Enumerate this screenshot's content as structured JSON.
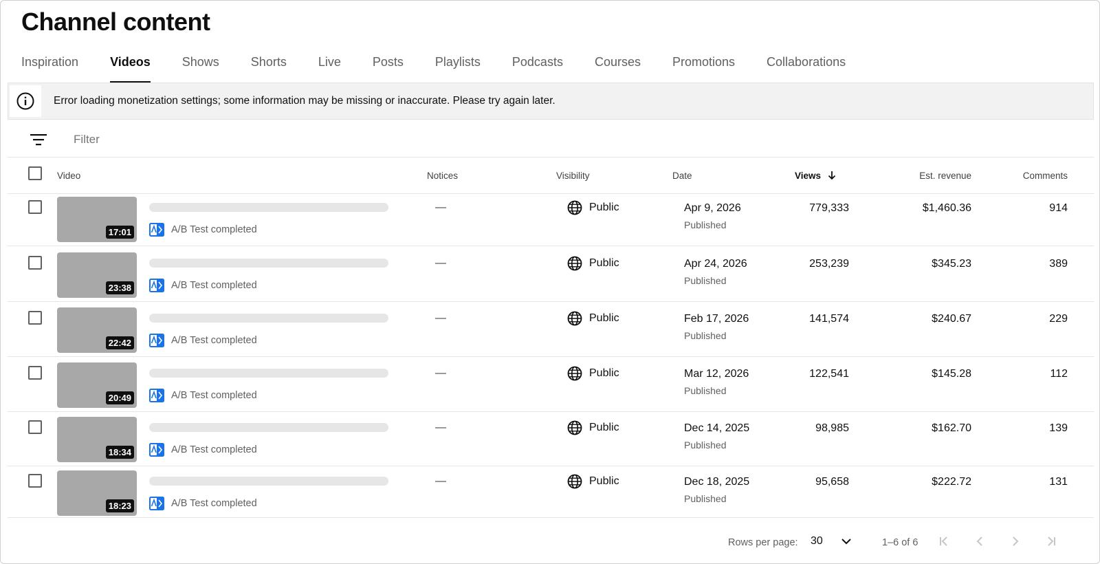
{
  "page": {
    "title": "Channel content"
  },
  "tabs": [
    {
      "label": "Inspiration",
      "active": false
    },
    {
      "label": "Videos",
      "active": true
    },
    {
      "label": "Shows",
      "active": false
    },
    {
      "label": "Shorts",
      "active": false
    },
    {
      "label": "Live",
      "active": false
    },
    {
      "label": "Posts",
      "active": false
    },
    {
      "label": "Playlists",
      "active": false
    },
    {
      "label": "Podcasts",
      "active": false
    },
    {
      "label": "Courses",
      "active": false
    },
    {
      "label": "Promotions",
      "active": false
    },
    {
      "label": "Collaborations",
      "active": false
    }
  ],
  "banner": {
    "icon": "info-icon",
    "text": "Error loading monetization settings; some information may be missing or inaccurate. Please try again later."
  },
  "filter": {
    "icon": "filter-icon",
    "placeholder": "Filter"
  },
  "table": {
    "headers": {
      "video": "Video",
      "notices": "Notices",
      "visibility": "Visibility",
      "date": "Date",
      "views": "Views",
      "revenue": "Est. revenue",
      "comments": "Comments"
    },
    "sort": {
      "column": "views",
      "direction": "descending",
      "icon": "arrow-down-icon"
    },
    "rows": [
      {
        "duration": "17:01",
        "ab_test": "A/B Test completed",
        "notice": "—",
        "visibility": "Public",
        "date": "Apr 9, 2026",
        "status": "Published",
        "views": "779,333",
        "revenue": "$1,460.36",
        "comments": "914"
      },
      {
        "duration": "23:38",
        "ab_test": "A/B Test completed",
        "notice": "—",
        "visibility": "Public",
        "date": "Apr 24, 2026",
        "status": "Published",
        "views": "253,239",
        "revenue": "$345.23",
        "comments": "389"
      },
      {
        "duration": "22:42",
        "ab_test": "A/B Test completed",
        "notice": "—",
        "visibility": "Public",
        "date": "Feb 17, 2026",
        "status": "Published",
        "views": "141,574",
        "revenue": "$240.67",
        "comments": "229"
      },
      {
        "duration": "20:49",
        "ab_test": "A/B Test completed",
        "notice": "—",
        "visibility": "Public",
        "date": "Mar 12, 2026",
        "status": "Published",
        "views": "122,541",
        "revenue": "$145.28",
        "comments": "112"
      },
      {
        "duration": "18:34",
        "ab_test": "A/B Test completed",
        "notice": "—",
        "visibility": "Public",
        "date": "Dec 14, 2025",
        "status": "Published",
        "views": "98,985",
        "revenue": "$162.70",
        "comments": "139"
      },
      {
        "duration": "18:23",
        "ab_test": "A/B Test completed",
        "notice": "—",
        "visibility": "Public",
        "date": "Dec 18, 2025",
        "status": "Published",
        "views": "95,658",
        "revenue": "$222.72",
        "comments": "131"
      }
    ]
  },
  "pagination": {
    "rows_per_page_label": "Rows per page:",
    "rows_per_page_value": "30",
    "range": "1–6 of 6",
    "buttons": [
      "first-page-icon",
      "previous-page-icon",
      "next-page-icon",
      "last-page-icon"
    ]
  },
  "colors": {
    "ab_icon": "#1a73e8",
    "thumbnail": "#a8a8a8",
    "banner_bg": "#f2f2f2",
    "pager_disabled": "#c6c6c6"
  }
}
